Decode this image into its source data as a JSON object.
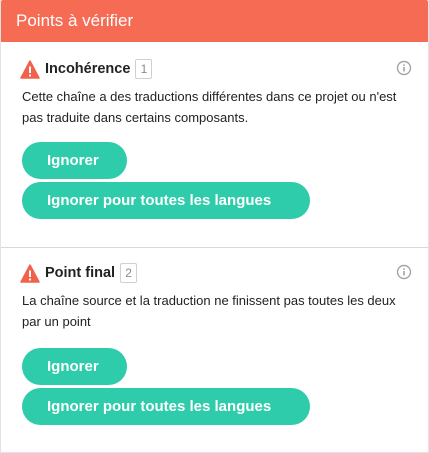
{
  "panel": {
    "title": "Points à vérifier",
    "header_color": "#f66b54"
  },
  "checks": [
    {
      "title": "Incohérence",
      "count": "1",
      "icon": "warning-icon",
      "description": "Cette chaîne a des traductions différentes dans ce projet ou n'est pas traduite dans certains composants.",
      "ignore_label": "Ignorer",
      "ignore_all_label": "Ignorer pour toutes les langues"
    },
    {
      "title": "Point final",
      "count": "2",
      "icon": "warning-icon",
      "description": "La chaîne source et la traduction ne finissent pas toutes les deux par un point",
      "ignore_label": "Ignorer",
      "ignore_all_label": "Ignorer pour toutes les langues"
    }
  ],
  "colors": {
    "accent_button": "#2eccaa",
    "warning": "#f0634a"
  }
}
